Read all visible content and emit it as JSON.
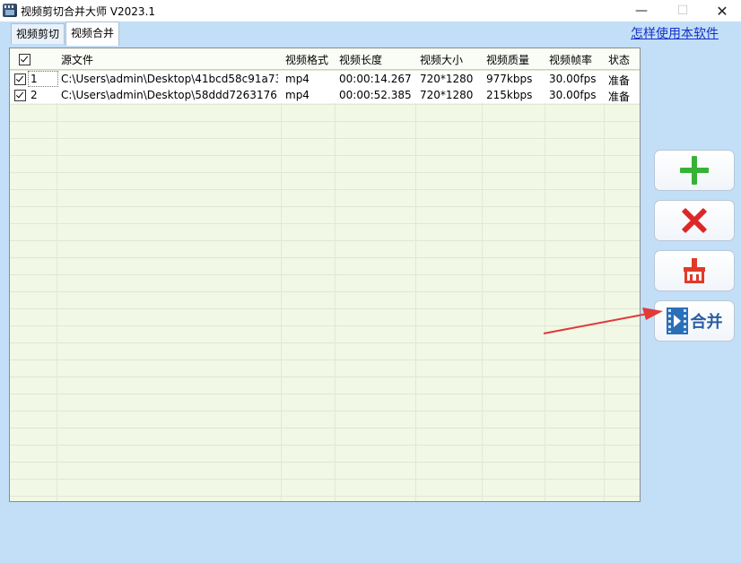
{
  "window": {
    "title": "视频剪切合并大师 V2023.1",
    "minimize": "—",
    "maximize": "☐",
    "close": "✕"
  },
  "tabs": [
    {
      "label": "视频剪切",
      "active": false
    },
    {
      "label": "视频合并",
      "active": true
    }
  ],
  "help_link": "怎样使用本软件",
  "table": {
    "columns": [
      "源文件",
      "视频格式",
      "视频长度",
      "视频大小",
      "视频质量",
      "视频帧率",
      "状态"
    ],
    "rows": [
      {
        "index": "1",
        "checked": true,
        "source": "C:\\Users\\admin\\Desktop\\41bcd58c91a73...",
        "format": "mp4",
        "duration": "00:00:14.267",
        "size": "720*1280",
        "quality": "977kbps",
        "fps": "30.00fps",
        "status": "准备"
      },
      {
        "index": "2",
        "checked": true,
        "source": "C:\\Users\\admin\\Desktop\\58ddd7263176...",
        "format": "mp4",
        "duration": "00:00:52.385",
        "size": "720*1280",
        "quality": "215kbps",
        "fps": "30.00fps",
        "status": "准备"
      }
    ]
  },
  "side_buttons": {
    "add": "plus-icon",
    "delete": "x-icon",
    "clear": "broom-icon",
    "merge_label": "合并"
  },
  "colors": {
    "background": "#c3def7",
    "grid_bg": "#f1f8e6",
    "add": "#36b336",
    "delete": "#dd2727",
    "merge_text": "#2a5da2",
    "arrow": "#e03a3a",
    "link": "#1330c8"
  }
}
